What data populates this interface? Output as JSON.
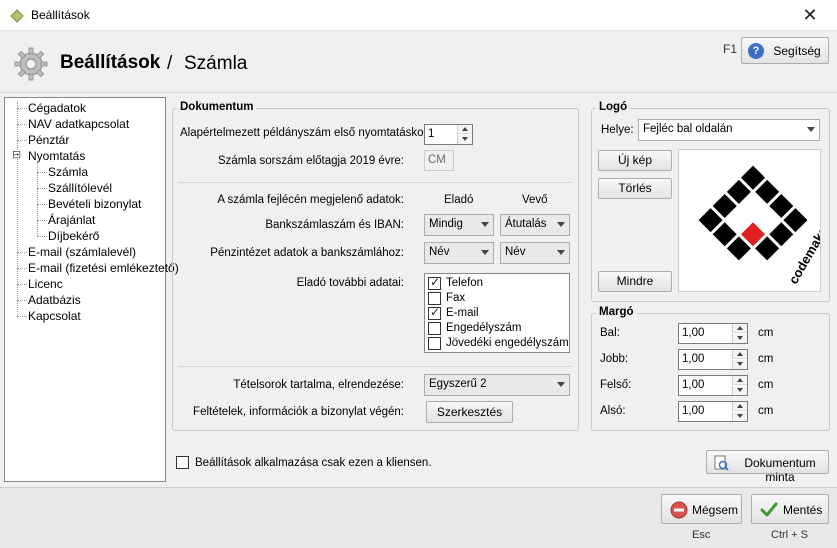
{
  "window": {
    "title": "Beállítások",
    "close_glyph": "✕"
  },
  "header": {
    "title": "Beállítások",
    "separator": "/",
    "subtitle": "Számla",
    "f1": "F1",
    "help_label": "Segítség",
    "help_icon": "?"
  },
  "tree": {
    "items": [
      {
        "label": "Cégadatok"
      },
      {
        "label": "NAV adatkapcsolat"
      },
      {
        "label": "Pénztár"
      },
      {
        "label": "Nyomtatás",
        "expander": "⊟"
      },
      {
        "label": "Számla"
      },
      {
        "label": "Szállítólevél"
      },
      {
        "label": "Bevételi bizonylat"
      },
      {
        "label": "Árajánlat"
      },
      {
        "label": "Díjbekérő"
      },
      {
        "label": "E-mail (számlalevél)"
      },
      {
        "label": "E-mail (fizetési emlékeztető)"
      },
      {
        "label": "Licenc"
      },
      {
        "label": "Adatbázis"
      },
      {
        "label": "Kapcsolat"
      }
    ]
  },
  "document": {
    "legend": "Dokumentum",
    "copy_number_label": "Alapértelmezett példányszám első nyomtatáskor:",
    "copy_number_value": "1",
    "prefix_label": "Számla sorszám előtagja 2019 évre:",
    "prefix_value": "CM",
    "header_data_label": "A számla fejlécén megjelenő adatok:",
    "col_seller": "Eladó",
    "col_buyer": "Vevő",
    "bank_label": "Bankszámlaszám és IBAN:",
    "bank_seller": "Mindig",
    "bank_buyer": "Átutalás",
    "fin_label": "Pénzintézet adatok a bankszámlához:",
    "fin_seller": "Név",
    "fin_buyer": "Név",
    "extra_label": "Eladó további adatai:",
    "extra_items": [
      {
        "label": "Telefon",
        "checked": true
      },
      {
        "label": "Fax",
        "checked": false
      },
      {
        "label": "E-mail",
        "checked": true
      },
      {
        "label": "Engedélyszám",
        "checked": false
      },
      {
        "label": "Jövedéki engedélyszám",
        "checked": false
      }
    ],
    "lines_label": "Tételsorok tartalma, elrendezése:",
    "lines_value": "Egyszerű 2",
    "terms_label": "Feltételek, információk a bizonylat végén:",
    "edit_button": "Szerkesztés"
  },
  "logo": {
    "legend": "Logó",
    "position_label": "Helye:",
    "position_value": "Fejléc bal oldalán",
    "new_button": "Új kép",
    "delete_button": "Törlés",
    "all_button": "Mindre",
    "brand_text": "codemakers"
  },
  "margin": {
    "legend": "Margó",
    "unit": "cm",
    "rows": [
      {
        "label": "Bal:",
        "value": "1,00"
      },
      {
        "label": "Jobb:",
        "value": "1,00"
      },
      {
        "label": "Felső:",
        "value": "1,00"
      },
      {
        "label": "Alsó:",
        "value": "1,00"
      }
    ]
  },
  "client_only_label": "Beállítások alkalmazása csak ezen a kliensen.",
  "sample_button": "Dokumentum minta",
  "footer": {
    "cancel_label": "Mégsem",
    "cancel_key": "Esc",
    "save_label": "Mentés",
    "save_key": "Ctrl + S"
  },
  "colors": {
    "accent_blue": "#3d6fc4",
    "logo_red": "#e02020",
    "cancel_red": "#d9534f",
    "save_green": "#3a9a2a"
  }
}
